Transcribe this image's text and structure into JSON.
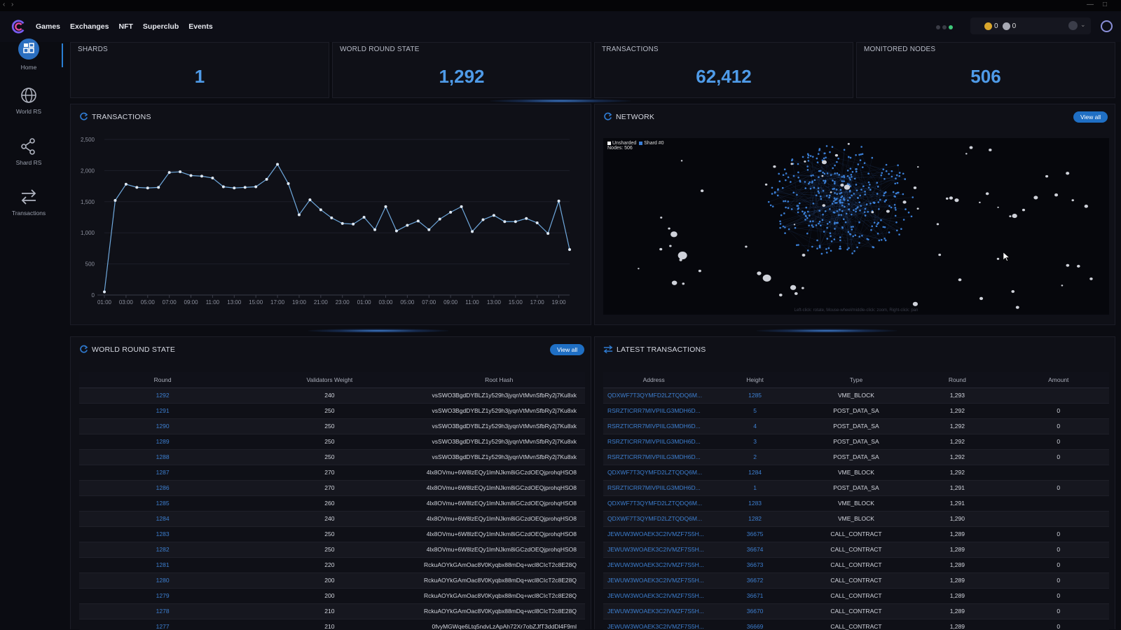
{
  "nav": {
    "items": [
      "Games",
      "Exchanges",
      "NFT",
      "Superclub",
      "Events"
    ]
  },
  "wallet": {
    "balance_1": "0",
    "balance_2": "0",
    "status_colors": [
      "#3a3c46",
      "#3a3c46",
      "#3fc97a"
    ]
  },
  "sidebar": {
    "items": [
      {
        "label": "Home",
        "icon": "home-icon"
      },
      {
        "label": "World RS",
        "icon": "globe-icon"
      },
      {
        "label": "Shard RS",
        "icon": "share-icon"
      },
      {
        "label": "Transactions",
        "icon": "arrows-icon"
      }
    ]
  },
  "stats": [
    {
      "label": "SHARDS",
      "value": "1"
    },
    {
      "label": "WORLD ROUND STATE",
      "value": "1,292"
    },
    {
      "label": "TRANSACTIONS",
      "value": "62,412"
    },
    {
      "label": "MONITORED NODES",
      "value": "506"
    }
  ],
  "transactions_chart": {
    "title": "TRANSACTIONS",
    "chart_data": {
      "type": "line",
      "x": [
        "01:00",
        "",
        "03:00",
        "",
        "05:00",
        "",
        "07:00",
        "",
        "09:00",
        "",
        "11:00",
        "",
        "13:00",
        "",
        "15:00",
        "",
        "17:00",
        "",
        "19:00",
        "",
        "21:00",
        "",
        "23:00",
        "",
        "01:00",
        "",
        "03:00",
        "",
        "05:00",
        "",
        "07:00",
        "",
        "09:00",
        "",
        "11:00",
        "",
        "13:00",
        "",
        "15:00",
        "",
        "17:00",
        "",
        "19:00",
        "",
        ""
      ],
      "xticks": [
        "01:00",
        "03:00",
        "05:00",
        "07:00",
        "09:00",
        "11:00",
        "13:00",
        "15:00",
        "17:00",
        "19:00",
        "21:00",
        "23:00",
        "01:00",
        "03:00",
        "05:00",
        "07:00",
        "09:00",
        "11:00",
        "13:00",
        "15:00",
        "17:00",
        "19:00"
      ],
      "values": [
        50,
        1520,
        1780,
        1730,
        1720,
        1730,
        1970,
        1980,
        1920,
        1910,
        1880,
        1740,
        1720,
        1730,
        1740,
        1860,
        2100,
        1790,
        1290,
        1530,
        1370,
        1240,
        1150,
        1140,
        1250,
        1050,
        1420,
        1030,
        1120,
        1190,
        1050,
        1220,
        1330,
        1420,
        1020,
        1210,
        1280,
        1180,
        1180,
        1230,
        1160,
        990,
        1510,
        730
      ],
      "ylim": [
        0,
        2500
      ],
      "yticks": [
        "2,500",
        "2,000",
        "1,500",
        "1,000",
        "500",
        "0"
      ]
    }
  },
  "network": {
    "title": "NETWORK",
    "view_all": "View all",
    "legend_unsharded": "Unsharded",
    "legend_shard": "Shard #0",
    "nodes_label": "Nodes: 506",
    "hint": "Left-click: rotate, Mouse-wheel/middle-click: zoom, Right-click: pan"
  },
  "world_round_state": {
    "title": "WORLD ROUND STATE",
    "view_all": "View all",
    "columns": [
      "Round",
      "Validators Weight",
      "Root Hash"
    ],
    "rows": [
      [
        "1292",
        "240",
        "vsSWO3BgdDYBLZ1y529h3jyqnVtMvnSfbRy2j7Ku8xk"
      ],
      [
        "1291",
        "250",
        "vsSWO3BgdDYBLZ1y529h3jyqnVtMvnSfbRy2j7Ku8xk"
      ],
      [
        "1290",
        "250",
        "vsSWO3BgdDYBLZ1y529h3jyqnVtMvnSfbRy2j7Ku8xk"
      ],
      [
        "1289",
        "250",
        "vsSWO3BgdDYBLZ1y529h3jyqnVtMvnSfbRy2j7Ku8xk"
      ],
      [
        "1288",
        "250",
        "vsSWO3BgdDYBLZ1y529h3jyqnVtMvnSfbRy2j7Ku8xk"
      ],
      [
        "1287",
        "270",
        "4lx8OVmu+6W8lzEQy1lmNJkm8iGCzdOEQjprohqHSO8"
      ],
      [
        "1286",
        "270",
        "4lx8OVmu+6W8lzEQy1lmNJkm8iGCzdOEQjprohqHSO8"
      ],
      [
        "1285",
        "260",
        "4lx8OVmu+6W8lzEQy1lmNJkm8iGCzdOEQjprohqHSO8"
      ],
      [
        "1284",
        "240",
        "4lx8OVmu+6W8lzEQy1lmNJkm8iGCzdOEQjprohqHSO8"
      ],
      [
        "1283",
        "250",
        "4lx8OVmu+6W8lzEQy1lmNJkm8iGCzdOEQjprohqHSO8"
      ],
      [
        "1282",
        "250",
        "4lx8OVmu+6W8lzEQy1lmNJkm8iGCzdOEQjprohqHSO8"
      ],
      [
        "1281",
        "220",
        "RckuAOYkGAmOac8V0Kyqbx88mDq+wcl8CIcT2c8E28Q"
      ],
      [
        "1280",
        "200",
        "RckuAOYkGAmOac8V0Kyqbx88mDq+wcl8CIcT2c8E28Q"
      ],
      [
        "1279",
        "200",
        "RckuAOYkGAmOac8V0Kyqbx88mDq+wcl8CIcT2c8E28Q"
      ],
      [
        "1278",
        "210",
        "RckuAOYkGAmOac8V0Kyqbx88mDq+wcl8CIcT2c8E28Q"
      ],
      [
        "1277",
        "210",
        "0fvyMGWqe6Ltq5ndvLzApAh72Xr7obZJfT3ddDl4F9ml"
      ]
    ]
  },
  "latest_transactions": {
    "title": "LATEST TRANSACTIONS",
    "columns": [
      "Address",
      "Height",
      "Type",
      "Round",
      "Amount"
    ],
    "rows": [
      [
        "QDXWF7T3QYMFD2LZTQDQ6M...",
        "1285",
        "VME_BLOCK",
        "1,293",
        ""
      ],
      [
        "RSRZTICRR7MIVPIILG3MDH6D...",
        "5",
        "POST_DATA_SA",
        "1,292",
        "0"
      ],
      [
        "RSRZTICRR7MIVPIILG3MDH6D...",
        "4",
        "POST_DATA_SA",
        "1,292",
        "0"
      ],
      [
        "RSRZTICRR7MIVPIILG3MDH6D...",
        "3",
        "POST_DATA_SA",
        "1,292",
        "0"
      ],
      [
        "RSRZTICRR7MIVPIILG3MDH6D...",
        "2",
        "POST_DATA_SA",
        "1,292",
        "0"
      ],
      [
        "QDXWF7T3QYMFD2LZTQDQ6M...",
        "1284",
        "VME_BLOCK",
        "1,292",
        ""
      ],
      [
        "RSRZTICRR7MIVPIILG3MDH6D...",
        "1",
        "POST_DATA_SA",
        "1,291",
        "0"
      ],
      [
        "QDXWF7T3QYMFD2LZTQDQ6M...",
        "1283",
        "VME_BLOCK",
        "1,291",
        ""
      ],
      [
        "QDXWF7T3QYMFD2LZTQDQ6M...",
        "1282",
        "VME_BLOCK",
        "1,290",
        ""
      ],
      [
        "JEWUW3WOAEK3C2IVMZF7S5H...",
        "36675",
        "CALL_CONTRACT",
        "1,289",
        "0"
      ],
      [
        "JEWUW3WOAEK3C2IVMZF7S5H...",
        "36674",
        "CALL_CONTRACT",
        "1,289",
        "0"
      ],
      [
        "JEWUW3WOAEK3C2IVMZF7S5H...",
        "36673",
        "CALL_CONTRACT",
        "1,289",
        "0"
      ],
      [
        "JEWUW3WOAEK3C2IVMZF7S5H...",
        "36672",
        "CALL_CONTRACT",
        "1,289",
        "0"
      ],
      [
        "JEWUW3WOAEK3C2IVMZF7S5H...",
        "36671",
        "CALL_CONTRACT",
        "1,289",
        "0"
      ],
      [
        "JEWUW3WOAEK3C2IVMZF7S5H...",
        "36670",
        "CALL_CONTRACT",
        "1,289",
        "0"
      ],
      [
        "JEWUW3WOAEK3C2IVMZF7S5H...",
        "36669",
        "CALL_CONTRACT",
        "1,289",
        "0"
      ]
    ]
  }
}
